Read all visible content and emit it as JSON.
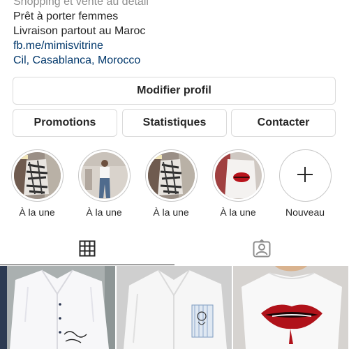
{
  "profile": {
    "bio_lines": [
      "Shopping et vente au détail",
      "Prêt à porter femmes",
      "Livraison partout au Maroc"
    ],
    "link": "fb.me/mimisvitrine",
    "location": "Cil, Casablanca, Morocco"
  },
  "buttons": {
    "edit_profile": "Modifier profil",
    "promotions": "Promotions",
    "statistics": "Statistiques",
    "contact": "Contacter"
  },
  "highlights": [
    {
      "label": "À la une",
      "icon": "zebra-top-photo"
    },
    {
      "label": "À la une",
      "icon": "jeans-outfit-photo"
    },
    {
      "label": "À la une",
      "icon": "zebra-top-photo"
    },
    {
      "label": "À la une",
      "icon": "lips-shirt-photo"
    },
    {
      "label": "Nouveau",
      "icon": "plus-icon"
    }
  ],
  "tabs": [
    {
      "name": "posts-grid",
      "icon": "grid-icon",
      "active": true
    },
    {
      "name": "tagged",
      "icon": "tagged-person-icon",
      "active": false
    }
  ],
  "posts": [
    {
      "icon": "white-shirt-print-photo"
    },
    {
      "icon": "white-shirt-pocket-photo"
    },
    {
      "icon": "white-top-lips-photo"
    }
  ],
  "colors": {
    "text": "#262626",
    "link": "#00376b",
    "border": "#dbdbdb",
    "background": "#ffffff"
  }
}
